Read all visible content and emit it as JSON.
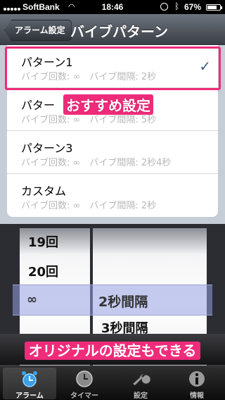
{
  "status_bar": {
    "carrier": "SoftBank",
    "time": "18:46",
    "battery": "67%",
    "battery_level": 0.67
  },
  "nav": {
    "back_label": "アラーム設定",
    "title": "バイブパターン"
  },
  "patterns": [
    {
      "title": "パターン1",
      "subtitle": "バイブ回数: ∞　バイブ間隔: 2秒",
      "selected": true
    },
    {
      "title": "パター",
      "subtitle": "バイブ回数: ∞　バイブ間隔: 5秒",
      "selected": false
    },
    {
      "title": "パターン3",
      "subtitle": "バイブ回数: ∞　バイブ間隔: 2秒4秒",
      "selected": false
    },
    {
      "title": "カスタム",
      "subtitle": "バイブ回数: ∞　バイブ間隔: 2秒",
      "selected": false
    }
  ],
  "selected_check": "✓",
  "recommended_label": "おすすめ設定",
  "picker": {
    "left_items": [
      "19回",
      "20回"
    ],
    "selected_left": "∞",
    "selected_right": "2秒間隔",
    "below_right": "3秒間隔"
  },
  "original_label": "オリジナルの設定もできる",
  "tabs": [
    {
      "label": "アラーム",
      "icon": "alarm-clock-icon",
      "active": true
    },
    {
      "label": "タイマー",
      "icon": "clock-icon",
      "active": false
    },
    {
      "label": "設定",
      "icon": "wrench-icon",
      "active": false
    },
    {
      "label": "情報",
      "icon": "info-icon",
      "active": false
    }
  ],
  "colors": {
    "accent": "#ef2c7a",
    "check": "#3c5b8c",
    "nav": "#3a3f47"
  }
}
